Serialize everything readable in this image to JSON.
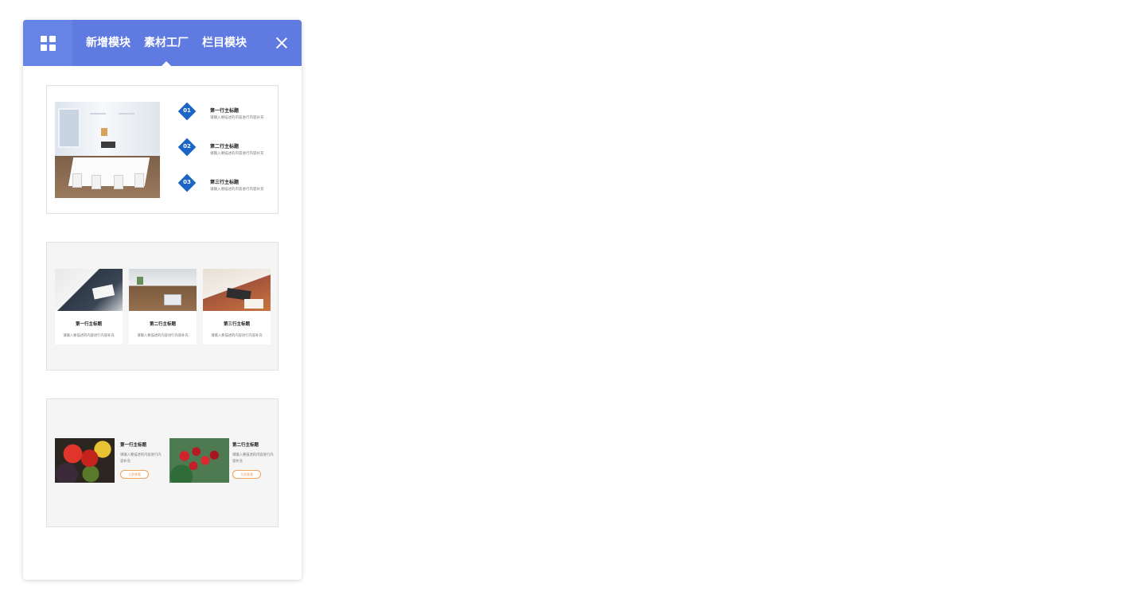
{
  "header": {
    "tabs": [
      {
        "label": "新增模块",
        "active": false
      },
      {
        "label": "素材工厂",
        "active": true
      },
      {
        "label": "栏目模块",
        "active": false
      }
    ],
    "grid_icon": "grid-icon",
    "close_icon": "close-icon",
    "accent": "#5f7ae0"
  },
  "templates": {
    "steps_card": {
      "items": [
        {
          "num": "01",
          "title": "第一行主标题",
          "desc": "请输入要描述的内容进行内容补充"
        },
        {
          "num": "02",
          "title": "第二行主标题",
          "desc": "请输入要描述的内容进行内容补充"
        },
        {
          "num": "03",
          "title": "第三行主标题",
          "desc": "请输入要描述的内容进行内容补充"
        }
      ],
      "diamond_color": "#1a65c6"
    },
    "business_card": {
      "items": [
        {
          "title": "第一行主标题",
          "desc": "请输入要描述的内容进行内容补充"
        },
        {
          "title": "第二行主标题",
          "desc": "请输入要描述的内容进行内容补充"
        },
        {
          "title": "第三行主标题",
          "desc": "请输入要描述的内容进行内容补充"
        }
      ]
    },
    "fruit_card": {
      "items": [
        {
          "title": "第一行主标题",
          "desc": "请输入要描述的内容进行内容补充",
          "button": "立即查看"
        },
        {
          "title": "第二行主标题",
          "desc": "请输入要描述的内容进行内容补充",
          "button": "立即查看"
        }
      ],
      "button_color": "#f0a15a"
    }
  }
}
